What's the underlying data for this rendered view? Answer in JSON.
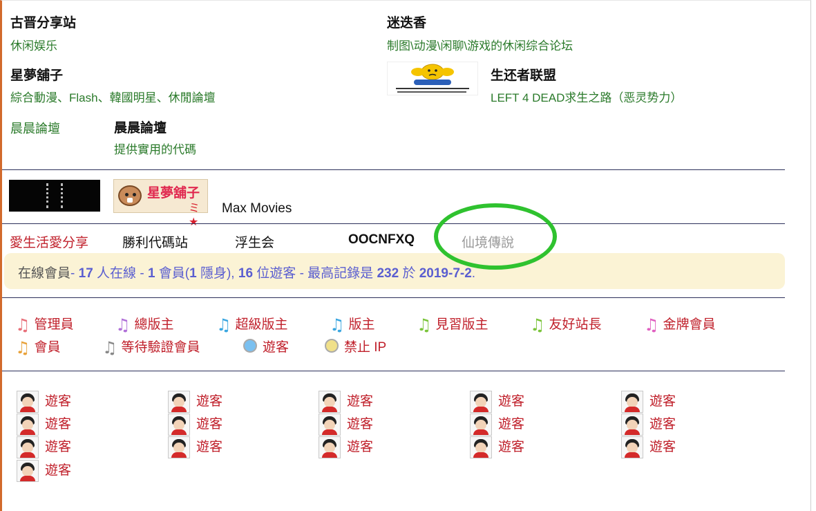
{
  "sites": [
    {
      "title": "古晋分享站",
      "desc": "休闲娱乐"
    },
    {
      "title": "迷迭香",
      "desc": "制图\\动漫\\闲聊\\游戏的休闲综合论坛"
    },
    {
      "title": "星夢舖子",
      "desc": "綜合動漫、Flash、韓國明星、休閒論壇"
    },
    {
      "title": "生还者联盟",
      "desc": "LEFT 4 DEAD求生之路（恶灵势力）"
    },
    {
      "title": "晨晨論壇",
      "desc": "提供實用的代碼"
    }
  ],
  "chenchen_link": "晨晨論壇",
  "image_links": {
    "bear_logo_text": "星夢舖子",
    "bear_logo_mark": "ミ★",
    "max_movies": "Max Movies"
  },
  "partners": [
    "愛生活愛分享",
    "勝利代碼站",
    "浮生会",
    "OOCNFXQ",
    "仙境傳說"
  ],
  "online": {
    "label": "在線會員",
    "sep1": "- ",
    "total": "17",
    "total_unit": " 人在線 - ",
    "members": "1",
    "members_unit": " 會員(",
    "hidden": "1",
    "hidden_unit": " 隱身), ",
    "guests": "16",
    "guests_unit": " 位遊客 - 最高記錄是 ",
    "record": "232",
    "record_unit": " 於 ",
    "record_date": "2019-7-2",
    "end": "."
  },
  "legend": [
    {
      "label": "管理員",
      "color": "#e8707a"
    },
    {
      "label": "總版主",
      "color": "#b070d8"
    },
    {
      "label": "超級版主",
      "color": "#3aa6e0"
    },
    {
      "label": "版主",
      "color": "#3aa6e0"
    },
    {
      "label": "見習版主",
      "color": "#7ac43a"
    },
    {
      "label": "友好站長",
      "color": "#7ac43a"
    },
    {
      "label": "金牌會員",
      "color": "#e060c0"
    },
    {
      "label": "會員",
      "color": "#e8a23a"
    },
    {
      "label": "等待驗證會員",
      "color": "#888888"
    },
    {
      "label": "遊客",
      "color": "#7ac0f0"
    },
    {
      "label": "禁止 IP",
      "color": "#f0e08a"
    }
  ],
  "guest_label": "遊客",
  "guest_count": 16
}
